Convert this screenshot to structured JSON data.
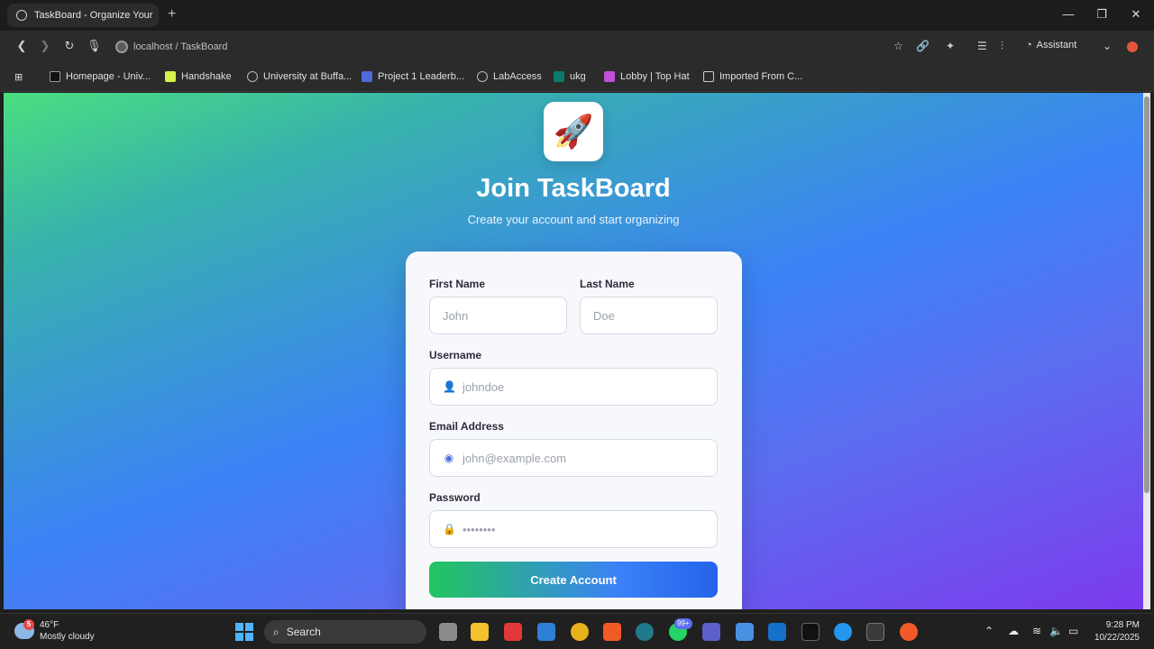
{
  "browser": {
    "tab_title": "TaskBoard - Organize Your W",
    "url_text": "localhost / TaskBoard",
    "assistant_label": "Assistant",
    "bookmarks": [
      {
        "label": "Homepage - Univ...",
        "icon": "dxl-icon",
        "color": "#111111"
      },
      {
        "label": "Handshake",
        "icon": "handshake-icon",
        "color": "#d7f24a"
      },
      {
        "label": "University at Buffa...",
        "icon": "globe-icon",
        "color": "#888888"
      },
      {
        "label": "Project 1 Leaderb...",
        "icon": "leaderboard-icon",
        "color": "#4f6bd8"
      },
      {
        "label": "LabAccess",
        "icon": "globe-icon",
        "color": "#888888"
      },
      {
        "label": "ukg",
        "icon": "ukg-icon",
        "color": "#0a7a6a"
      },
      {
        "label": "Lobby | Top Hat",
        "icon": "tophat-icon",
        "color": "#c24fd8"
      },
      {
        "label": "Imported From C...",
        "icon": "folder-icon",
        "color": "#cccccc"
      }
    ]
  },
  "page": {
    "logo_glyph": "🚀",
    "title": "Join TaskBoard",
    "subtitle": "Create your account and start organizing",
    "form": {
      "first_name_label": "First Name",
      "first_name_placeholder": "John",
      "last_name_label": "Last Name",
      "last_name_placeholder": "Doe",
      "username_label": "Username",
      "username_placeholder": "johndoe",
      "email_label": "Email Address",
      "email_placeholder": "john@example.com",
      "password_label": "Password",
      "password_placeholder": "••••••••",
      "submit_label": "Create Account"
    }
  },
  "taskbar": {
    "weather_badge": "5",
    "temperature": "46°F",
    "condition": "Mostly cloudy",
    "search_label": "Search",
    "whatsapp_badge": "99+",
    "time": "9:28 PM",
    "date": "10/22/2025"
  },
  "colors": {
    "accent_green": "#22c55e",
    "accent_blue": "#3b82f6",
    "accent_purple": "#7c3aed"
  }
}
